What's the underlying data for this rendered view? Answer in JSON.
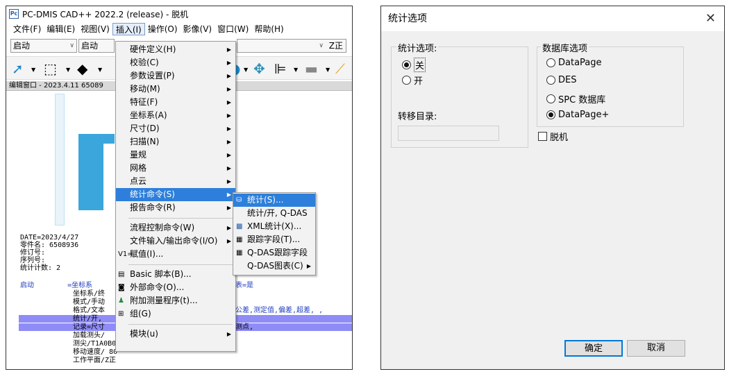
{
  "left_window": {
    "title": "PC-DMIS CAD++ 2022.2 (release) - 脱机",
    "app_icon_text": "Pc",
    "menubar": [
      "文件(F)",
      "编辑(E)",
      "视图(V)",
      "插入(I)",
      "操作(O)",
      "影像(V)",
      "窗口(W)",
      "帮助(H)"
    ],
    "combo1": "启动",
    "combo2": "启动",
    "combo3": "Z正",
    "edit_window_title": "编辑窗口 - 2023.4.11  65089",
    "code_lines": {
      "date": "DATE=2023/4/27",
      "part": "零件名: 6508936",
      "rev": "修订号:",
      "serial": "序列号:",
      "stats": "统计计数: 2",
      "l1": "启动        =坐标系",
      "l1b": "表=是",
      "l2": "坐标系/终",
      "l3": "模式/手动",
      "l4": "格式/文本",
      "l4b": "公差,测定值,偏差,超差, ,",
      "l5": "统计/开,",
      "l6": "记录=尺寸",
      "l6b": "测点,",
      "l7": "加载测头/",
      "l8": "测尖/T1A0B0, 支撑方向 IJK=0, 0, 1, 角度=0",
      "l9": "移动速度/ 80",
      "l10": "工作平面/Z正"
    },
    "insert_menu": [
      {
        "label": "硬件定义(H)",
        "sub": true
      },
      {
        "label": "校验(C)",
        "sub": true
      },
      {
        "label": "参数设置(P)",
        "sub": true
      },
      {
        "label": "移动(M)",
        "sub": true
      },
      {
        "label": "特征(F)",
        "sub": true
      },
      {
        "label": "坐标系(A)",
        "sub": true
      },
      {
        "label": "尺寸(D)",
        "sub": true
      },
      {
        "label": "扫描(N)",
        "sub": true
      },
      {
        "label": "量规",
        "sub": true
      },
      {
        "label": "网格",
        "sub": true
      },
      {
        "label": "点云",
        "sub": true
      },
      {
        "label": "统计命令(S)",
        "sub": true,
        "selected": true
      },
      {
        "label": "报告命令(R)",
        "sub": true
      },
      {
        "label": "流程控制命令(W)",
        "sub": true
      },
      {
        "label": "文件输入/输出命令(I/O)",
        "sub": true
      },
      {
        "label": "赋值(I)...",
        "sub": false
      },
      {
        "label": "Basic 脚本(B)...",
        "sub": false
      },
      {
        "label": "外部命令(O)...",
        "sub": false
      },
      {
        "label": "附加测量程序(t)...",
        "sub": false
      },
      {
        "label": "组(G)",
        "sub": false
      },
      {
        "label": "模块(u)",
        "sub": true
      }
    ],
    "stats_submenu": [
      {
        "label": "统计(S)...",
        "selected": true
      },
      {
        "label": "统计/开, Q-DAS"
      },
      {
        "label": "XML统计(X)..."
      },
      {
        "label": "跟踪字段(T)..."
      },
      {
        "label": "Q-DAS跟踪字段"
      },
      {
        "label": "Q-DAS图表(C)"
      }
    ]
  },
  "dialog": {
    "title": "统计选项",
    "close_glyph": "✕",
    "stats_group_label": "统计选项:",
    "stats_options": [
      {
        "label": "关",
        "checked": true
      },
      {
        "label": "开",
        "checked": false
      }
    ],
    "transfer_dir_label": "转移目录:",
    "transfer_dir_value": "",
    "db_group_label": "数据库选项",
    "db_options": [
      {
        "label": "DataPage",
        "checked": false
      },
      {
        "label": "DES",
        "checked": false
      },
      {
        "label": "SPC 数据库",
        "checked": false
      },
      {
        "label": "DataPage+",
        "checked": true
      }
    ],
    "offline_label": "脱机",
    "offline_checked": false,
    "ok_label": "确定",
    "cancel_label": "取消"
  }
}
